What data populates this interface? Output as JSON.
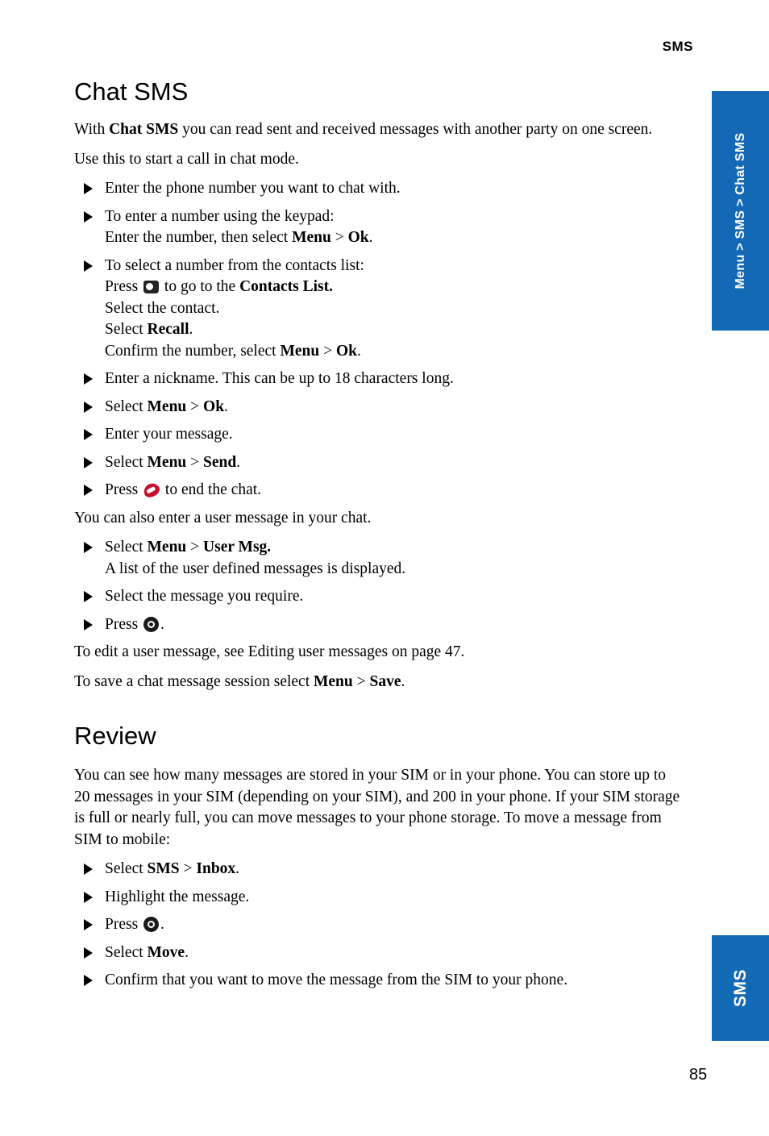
{
  "header": {
    "running_head": "SMS"
  },
  "side_tabs": {
    "breadcrumb": "Menu > SMS > Chat SMS",
    "chapter": "SMS"
  },
  "page_number": "85",
  "sections": [
    {
      "title": "Chat SMS",
      "intro_1_a": "With ",
      "intro_1_b": "Chat SMS",
      "intro_1_c": " you can read sent and received messages with another party on one screen.",
      "intro_2": "Use this to start a call in chat mode."
    },
    {
      "title": "Review",
      "intro": "You can see how many messages are stored in your SIM or in your phone. You can store up to 20 messages in your SIM (depending on your SIM), and 200 in your phone. If your SIM storage is full or nearly full, you can move messages to your phone storage. To move a message from SIM to mobile:"
    }
  ],
  "chat_steps": {
    "s1": "Enter the phone number you want to chat with.",
    "s2_l1": "To enter a number using the keypad:",
    "s2_l2_a": "Enter the number, then select ",
    "s2_l2_b": "Menu",
    "s2_l2_c": " > ",
    "s2_l2_d": "Ok",
    "s2_l2_e": ".",
    "s3_l1": " To select a number from the contacts list:",
    "s3_l2_a": "Press ",
    "s3_l2_b": " to go to the ",
    "s3_l2_c": "Contacts List.",
    "s3_l3": "Select the contact.",
    "s3_l4_a": "Select ",
    "s3_l4_b": "Recall",
    "s3_l4_c": ".",
    "s3_l5_a": "Confirm the number, select ",
    "s3_l5_b": "Menu",
    "s3_l5_c": " > ",
    "s3_l5_d": "Ok",
    "s3_l5_e": ".",
    "s4": "Enter a nickname. This can be up to 18 characters long.",
    "s5_a": "Select ",
    "s5_b": "Menu",
    "s5_c": " > ",
    "s5_d": "Ok",
    "s5_e": ".",
    "s6": "Enter your message.",
    "s7_a": "Select ",
    "s7_b": "Menu",
    "s7_c": " > ",
    "s7_d": "Send",
    "s7_e": ".",
    "s8_a": "Press ",
    "s8_b": " to end the chat."
  },
  "user_msg": {
    "lead": "You can also enter a user message in your chat.",
    "s1_l1_a": "Select ",
    "s1_l1_b": "Menu",
    "s1_l1_c": " > ",
    "s1_l1_d": "User Msg.",
    "s1_l2": "A list of the user defined messages is displayed.",
    "s2": "Select the message you require.",
    "s3_a": "Press ",
    "s3_b": ".",
    "note_1": "To edit a user message, see Editing user messages on page 47.",
    "note_2_a": "To save a chat message session select ",
    "note_2_b": "Menu",
    "note_2_c": " > ",
    "note_2_d": "Save",
    "note_2_e": "."
  },
  "review_steps": {
    "s1_a": "Select ",
    "s1_b": "SMS",
    "s1_c": " > ",
    "s1_d": "Inbox",
    "s1_e": ".",
    "s2": "Highlight the message.",
    "s3_a": "Press ",
    "s3_b": ".",
    "s4_a": "Select ",
    "s4_b": "Move",
    "s4_c": ".",
    "s5": "Confirm that you want to move the message from the SIM to your phone."
  },
  "icons": {
    "contacts": "contacts-book-icon",
    "end_call": "end-call-icon",
    "select": "select-key-icon"
  },
  "colors": {
    "tab_blue": "#1469b5",
    "end_call_red": "#c8102e"
  }
}
